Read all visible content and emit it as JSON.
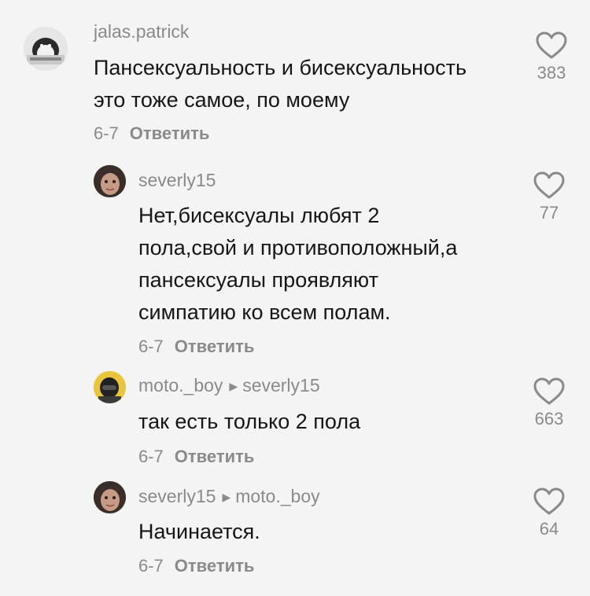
{
  "comments": [
    {
      "username": "jalas.patrick",
      "reply_to": "",
      "lines": [
        "Пансексуальность и бисексуальность",
        "это тоже самое, по моему"
      ],
      "date": "6-7",
      "reply_label": "Ответить",
      "likes": "383",
      "avatar": "penguin-avatar"
    },
    {
      "username": "severly15",
      "reply_to": "",
      "lines": [
        "Нет,бисексуалы любят 2",
        "пола,свой и противоположный,а",
        "пансексуалы проявляют",
        "симпатию ко всем полам."
      ],
      "date": "6-7",
      "reply_label": "Ответить",
      "likes": "77",
      "avatar": "face-avatar"
    },
    {
      "username": "moto._boy",
      "reply_to": "severly15",
      "lines": [
        "так есть только 2 пола"
      ],
      "date": "6-7",
      "reply_label": "Ответить",
      "likes": "663",
      "avatar": "helmet-avatar"
    },
    {
      "username": "severly15",
      "reply_to": "moto._boy",
      "lines": [
        "Начинается."
      ],
      "date": "6-7",
      "reply_label": "Ответить",
      "likes": "64",
      "avatar": "face-avatar"
    }
  ]
}
